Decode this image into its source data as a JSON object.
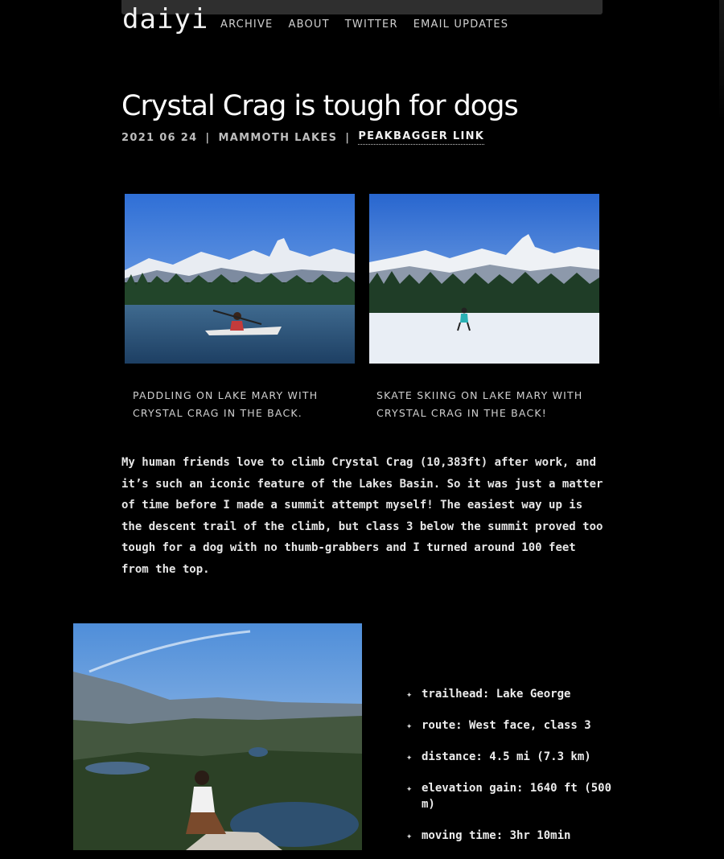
{
  "site": {
    "logo": "daiyi",
    "nav": [
      "ARCHIVE",
      "ABOUT",
      "TWITTER",
      "EMAIL UPDATES"
    ]
  },
  "post": {
    "title": "Crystal Crag is tough for dogs",
    "date": "2021 06 24",
    "location": "MAMMOTH LAKES",
    "separator": "|",
    "link_label": "PEAKBAGGER LINK",
    "photos": [
      {
        "caption": "PADDLING ON LAKE MARY WITH CRYSTAL CRAG IN THE BACK."
      },
      {
        "caption": "SKATE SKIING ON LAKE MARY WITH CRYSTAL CRAG IN THE BACK!"
      }
    ],
    "body": "My human friends love to climb Crystal Crag (10,383ft) after work, and it’s such an iconic feature of the Lakes Basin. So it was just a matter of time before I made a summit attempt myself! The easiest way up is the descent trail of the climb, but class 3 below the summit proved too tough for a dog with no thumb-grabbers and I turned around 100 feet from the top.",
    "bullet_glyph": "✦",
    "stats": [
      "trailhead: Lake George",
      "route: West face, class 3",
      "distance: 4.5 mi (7.3 km)",
      "elevation gain: 1640 ft (500 m)",
      "moving time: 3hr 10min"
    ]
  }
}
